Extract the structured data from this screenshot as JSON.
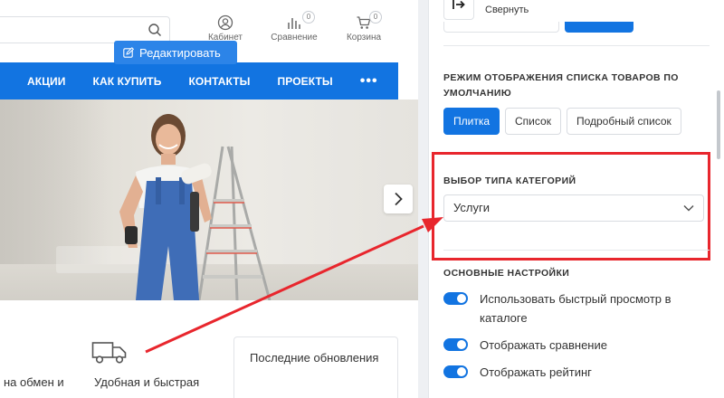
{
  "header": {
    "search": {
      "placeholder": ""
    },
    "cabinet_label": "Кабинет",
    "compare_label": "Сравнение",
    "compare_count": "0",
    "cart_label": "Корзина",
    "cart_count": "0"
  },
  "edit_button": {
    "label": "Редактировать"
  },
  "nav": {
    "items": [
      "АКЦИИ",
      "КАК КУПИТЬ",
      "КОНТАКТЫ",
      "ПРОЕКТЫ"
    ],
    "more": "•••"
  },
  "features": {
    "item1_partial": "на обмен и",
    "item2": "Удобная и быстрая"
  },
  "updates_box": {
    "text": "Последние обновления"
  },
  "panel": {
    "collapse_label": "Свернуть",
    "display_mode": {
      "title": "РЕЖИМ ОТОБРАЖЕНИЯ СПИСКА ТОВАРОВ ПО УМОЛЧАНИЮ",
      "options": [
        "Плитка",
        "Список",
        "Подробный список"
      ],
      "selected": "Плитка"
    },
    "category_type": {
      "title": "ВЫБОР ТИПА КАТЕГОРИЙ",
      "value": "Услуги"
    },
    "basic": {
      "title": "ОСНОВНЫЕ НАСТРОЙКИ",
      "toggles": [
        {
          "label": "Использовать быстрый просмотр в каталоге",
          "on": true
        },
        {
          "label": "Отображать сравнение",
          "on": true
        },
        {
          "label": "Отображать рейтинг",
          "on": true
        }
      ]
    }
  },
  "colors": {
    "accent": "#1274e1",
    "highlight": "#e8262d"
  }
}
